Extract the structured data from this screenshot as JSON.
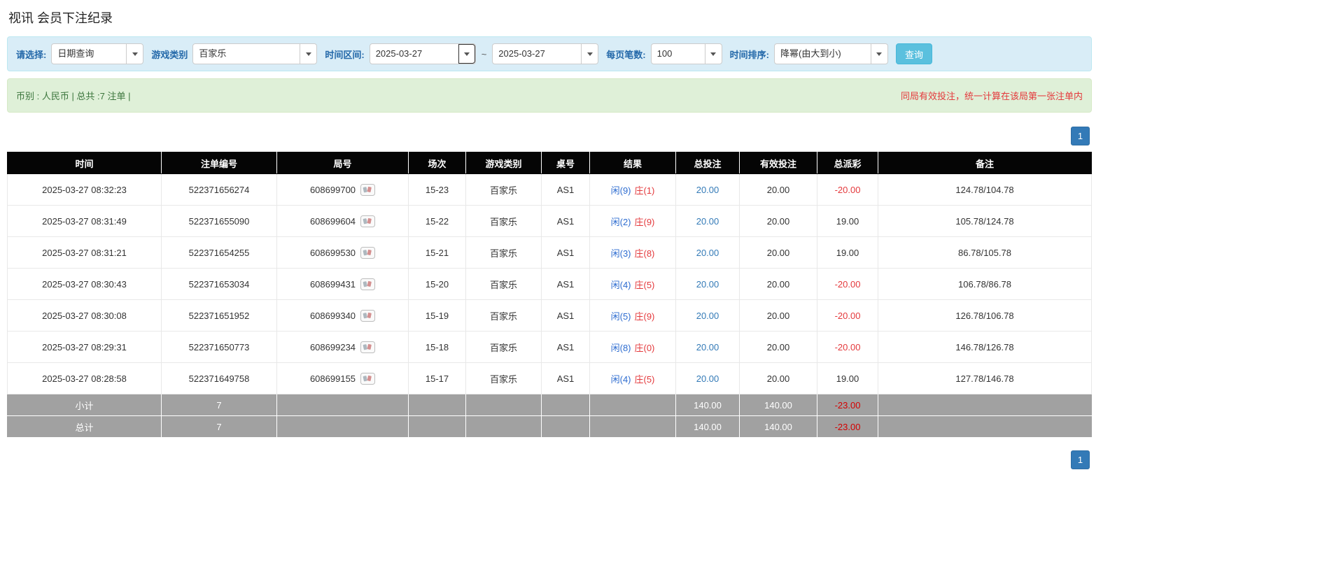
{
  "page": {
    "title": "视讯 会员下注纪录"
  },
  "colors": {
    "accent_blue": "#337ab7",
    "filter_bar_bg": "#d9edf7",
    "summary_bar_bg": "#dff0d8",
    "summary_text_green": "#3c763d",
    "warning_red": "#e4393c",
    "table_header_bg": "#000000",
    "table_footer_bg": "#a1a1a1",
    "link_blue": "#337ab7",
    "negative_red": "#e4393c",
    "search_button_bg": "#5bc0de"
  },
  "filters": {
    "select_label": "请选择:",
    "select_value": "日期查询",
    "game_type_label": "游戏类别",
    "game_type_value": "百家乐",
    "time_range_label": "时间区间:",
    "date_from": "2025-03-27",
    "date_separator": "~",
    "date_to": "2025-03-27",
    "page_size_label": "每页笔数:",
    "page_size_value": "100",
    "sort_label": "时间排序:",
    "sort_value": "降幂(由大到小)",
    "search_button": "查询"
  },
  "summary": {
    "left": "币别 : 人民币 | 总共 :7 注单 |",
    "right": "同局有效投注，统一计算在该局第一张注单内"
  },
  "pagination": {
    "page": "1"
  },
  "table": {
    "headers": [
      "时间",
      "注单编号",
      "局号",
      "场次",
      "游戏类别",
      "桌号",
      "结果",
      "总投注",
      "有效投注",
      "总派彩",
      "备注"
    ],
    "rows": [
      {
        "time": "2025-03-27 08:32:23",
        "bet_id": "522371656274",
        "round": "608699700",
        "session": "15-23",
        "game": "百家乐",
        "table_no": "AS1",
        "result_player": "闲(9)",
        "result_banker": "庄(1)",
        "total_bet": "20.00",
        "valid_bet": "20.00",
        "payout": "-20.00",
        "note": "124.78/104.78"
      },
      {
        "time": "2025-03-27 08:31:49",
        "bet_id": "522371655090",
        "round": "608699604",
        "session": "15-22",
        "game": "百家乐",
        "table_no": "AS1",
        "result_player": "闲(2)",
        "result_banker": "庄(9)",
        "total_bet": "20.00",
        "valid_bet": "20.00",
        "payout": "19.00",
        "note": "105.78/124.78"
      },
      {
        "time": "2025-03-27 08:31:21",
        "bet_id": "522371654255",
        "round": "608699530",
        "session": "15-21",
        "game": "百家乐",
        "table_no": "AS1",
        "result_player": "闲(3)",
        "result_banker": "庄(8)",
        "total_bet": "20.00",
        "valid_bet": "20.00",
        "payout": "19.00",
        "note": "86.78/105.78"
      },
      {
        "time": "2025-03-27 08:30:43",
        "bet_id": "522371653034",
        "round": "608699431",
        "session": "15-20",
        "game": "百家乐",
        "table_no": "AS1",
        "result_player": "闲(4)",
        "result_banker": "庄(5)",
        "total_bet": "20.00",
        "valid_bet": "20.00",
        "payout": "-20.00",
        "note": "106.78/86.78"
      },
      {
        "time": "2025-03-27 08:30:08",
        "bet_id": "522371651952",
        "round": "608699340",
        "session": "15-19",
        "game": "百家乐",
        "table_no": "AS1",
        "result_player": "闲(5)",
        "result_banker": "庄(9)",
        "total_bet": "20.00",
        "valid_bet": "20.00",
        "payout": "-20.00",
        "note": "126.78/106.78"
      },
      {
        "time": "2025-03-27 08:29:31",
        "bet_id": "522371650773",
        "round": "608699234",
        "session": "15-18",
        "game": "百家乐",
        "table_no": "AS1",
        "result_player": "闲(8)",
        "result_banker": "庄(0)",
        "total_bet": "20.00",
        "valid_bet": "20.00",
        "payout": "-20.00",
        "note": "146.78/126.78"
      },
      {
        "time": "2025-03-27 08:28:58",
        "bet_id": "522371649758",
        "round": "608699155",
        "session": "15-17",
        "game": "百家乐",
        "table_no": "AS1",
        "result_player": "闲(4)",
        "result_banker": "庄(5)",
        "total_bet": "20.00",
        "valid_bet": "20.00",
        "payout": "19.00",
        "note": "127.78/146.78"
      }
    ],
    "subtotal": {
      "label": "小计",
      "count": "7",
      "total_bet": "140.00",
      "valid_bet": "140.00",
      "payout": "-23.00"
    },
    "total": {
      "label": "总计",
      "count": "7",
      "total_bet": "140.00",
      "valid_bet": "140.00",
      "payout": "-23.00"
    }
  }
}
